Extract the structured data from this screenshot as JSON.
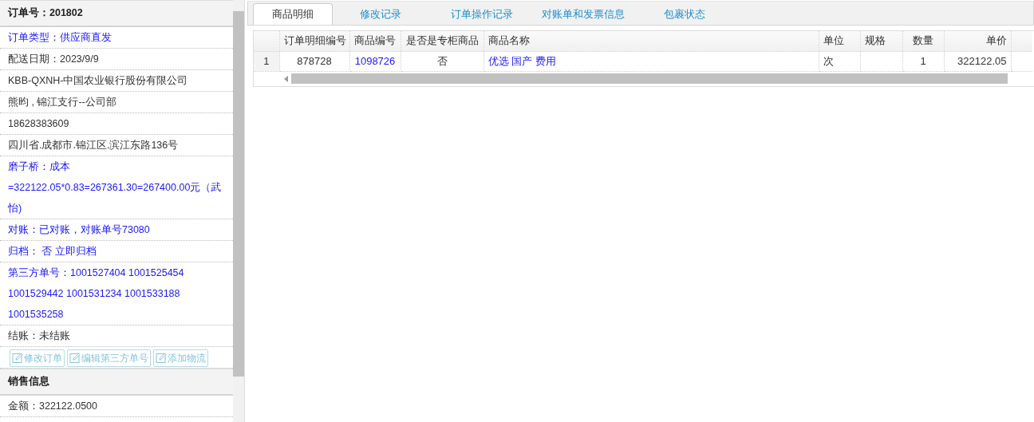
{
  "order_panel": {
    "title": "订单号：201802",
    "rows": [
      {
        "text": "订单类型：供应商直发",
        "kind": "note"
      },
      {
        "text": "配送日期：2023/9/9",
        "kind": "plain"
      },
      {
        "text": "KBB-QXNH-中国农业银行股份有限公司",
        "kind": "plain"
      },
      {
        "text": "熊昀 , 锦江支行--公司部",
        "kind": "plain"
      },
      {
        "text": "18628383609",
        "kind": "plain"
      },
      {
        "text": "四川省.成都市.锦江区.滨江东路136号",
        "kind": "plain"
      },
      {
        "text": "磨子桥：成本 =322122.05*0.83=267361.30=267400.00元（武怡)",
        "kind": "note"
      },
      {
        "text": "对账：已对账，对账单号73080",
        "kind": "note"
      },
      {
        "text": "归档： 否 立即归档",
        "kind": "note"
      },
      {
        "text": "第三方单号：1001527404 1001525454 1001529442 1001531234 1001533188 1001535258",
        "kind": "note"
      },
      {
        "text": "结账：未结账",
        "kind": "plain"
      }
    ],
    "buttons": [
      {
        "label": "修改订单",
        "disabled": true
      },
      {
        "label": "编辑第三方单号",
        "disabled": true
      },
      {
        "label": "添加物流",
        "disabled": true
      }
    ]
  },
  "sales_panel": {
    "title": "销售信息",
    "rows": [
      {
        "text": "金额：322122.0500",
        "kind": "plain"
      }
    ]
  },
  "tabs": [
    {
      "label": "商品明细",
      "selected": true
    },
    {
      "label": "修改记录",
      "selected": false
    },
    {
      "label": "订单操作记录",
      "selected": false
    },
    {
      "label": "对账单和发票信息",
      "selected": false
    },
    {
      "label": "包裹状态",
      "selected": false
    }
  ],
  "table": {
    "columns": [
      {},
      {
        "label": "订单明细编号"
      },
      {
        "label": "商品编号"
      },
      {
        "label": "是否是专柜商品"
      },
      {
        "label": "商品名称"
      },
      {
        "label": "单位"
      },
      {
        "label": "规格"
      },
      {
        "label": "数量"
      },
      {
        "label": "单价"
      }
    ],
    "rows": [
      {
        "cells": [
          {
            "text": "1",
            "link": false
          },
          {
            "text": "878728",
            "link": false
          },
          {
            "text": "1098726",
            "link": true
          },
          {
            "text": "否",
            "link": false
          },
          {
            "text": "优选 国产 费用",
            "link": true
          },
          {
            "text": "次",
            "link": false
          },
          {},
          {
            "text": "1",
            "link": false
          },
          {
            "text": "322122.05",
            "link": false
          }
        ]
      }
    ]
  }
}
